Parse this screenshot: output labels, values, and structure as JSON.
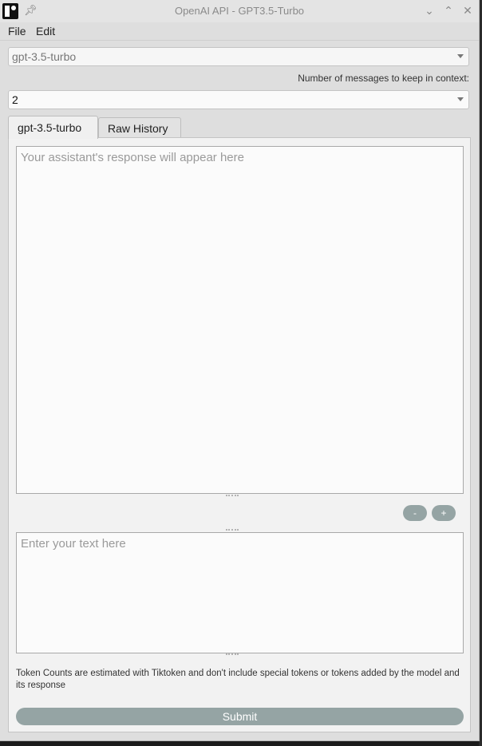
{
  "window": {
    "title": "OpenAI API - GPT3.5-Turbo"
  },
  "menu": {
    "file_label": "File",
    "edit_label": "Edit"
  },
  "model_select": {
    "value": "gpt-3.5-turbo"
  },
  "context": {
    "label": "Number of messages to keep in context:",
    "value": "2"
  },
  "tabs": [
    {
      "label": "gpt-3.5-turbo",
      "active": true
    },
    {
      "label": "Raw History",
      "active": false
    }
  ],
  "response": {
    "placeholder": "Your assistant's response will appear here"
  },
  "font_controls": {
    "decrease_label": "-",
    "increase_label": "+"
  },
  "input": {
    "placeholder": "Enter your text here"
  },
  "note": "Token Counts are estimated with Tiktoken and don't include special tokens or tokens added by the model and its response",
  "submit_label": "Submit",
  "colors": {
    "button_bg": "#95a4a4",
    "window_bg": "#dedede"
  }
}
